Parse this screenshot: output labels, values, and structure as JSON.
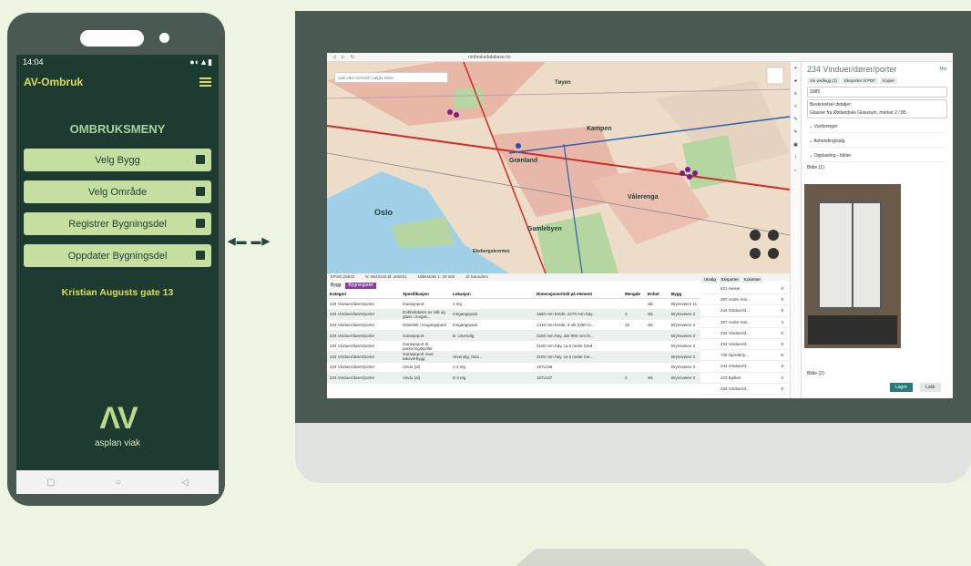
{
  "phone": {
    "status_time": "14:04",
    "app_title": "AV-Ombruk",
    "menu_title": "OMBRUKSMENY",
    "buttons": [
      "Velg Bygg",
      "Velg Område",
      "Registrer Bygningsdel",
      "Oppdater Bygningsdel"
    ],
    "address": "Kristian Augusts gate 13",
    "logo_text": "asplan viak"
  },
  "browser": {
    "url": "ombruksdatabase.no",
    "search_placeholder": "Søk etter innhold i valgte kilder",
    "map_labels": [
      "Oslo",
      "Grønland",
      "Kampen",
      "Vålerenga",
      "Gamlebyen",
      "Tøyen",
      "Ekebergskrenten"
    ],
    "map_status": [
      "EPSG:25832",
      "N: 6643149 Ø: 260021",
      "Målestokk 1: 20 000",
      "Jil Saunders"
    ],
    "bygg_tab": "Bygg",
    "bygningsdel_tab": "Bygningsdel",
    "table": {
      "headers": [
        "Kategori",
        "Spesifikasjon",
        "Lokasjon",
        "Dimensjoner/mål på element",
        "Mengde",
        "Enhet",
        "Bygg"
      ],
      "rows": [
        [
          "234 Vinduer/dører/porter",
          "Garasjeport",
          "1 etg",
          "",
          "",
          "stk",
          "Brynsveien 11"
        ],
        [
          "234 Vinduer/dører/porter",
          "Dobbeltdører av stål og glass i inngan...",
          "Inngangsparti",
          "1580 mm brede, 2270 mm høy...",
          "4",
          "stk",
          "Brynsveien 3"
        ],
        [
          "234 Vinduer/dører/porter",
          "Glassfelt i inngangsparti",
          "Inngangsparti",
          "1410 mm brede, 8 stk 2350 m...",
          "16",
          "stk",
          "Brynsveien 3"
        ],
        [
          "234 Vinduer/dører/porter",
          "Garasjeport",
          "B. Utvendig",
          "2200 mm høy, dør 900 mm br...",
          "",
          "",
          "Brynsveien 3"
        ],
        [
          "234 Vinduer/dører/porter",
          "Garasjeport til parkeringskjeller",
          "",
          "2100 mm høy, ca 6 meter bred",
          "",
          "",
          "Brynsveien 3"
        ],
        [
          "234 Vinduer/dører/porter",
          "Garasjeport med takoverbygg",
          "Utvendig, fasa...",
          "2100 mm høy, ca 6 meter bre...",
          "",
          "",
          "Brynsveien 3"
        ],
        [
          "234 Vinduer/dører/porter",
          "Vindu (al)",
          "A 2 etg",
          "157x138",
          "",
          "",
          "Brynsveien 3"
        ],
        [
          "234 Vinduer/dører/porter",
          "Vindu (al)",
          "B 3 etg",
          "157x137",
          "2",
          "stk",
          "Brynsveien 3"
        ]
      ]
    },
    "side_buttons": [
      "Utvalg",
      "Eksporter",
      "Kolonner"
    ],
    "side_items": [
      [
        "621 Heiser",
        "0"
      ],
      [
        "287 Andre reis...",
        "0"
      ],
      [
        "244 Vinduer/d...",
        "0"
      ],
      [
        "287 Andre reis...",
        "4"
      ],
      [
        "234 Vinduer/d...",
        "0"
      ],
      [
        "234 Vinduer/d...",
        "5"
      ],
      [
        "725 Gjerder/p...",
        "6"
      ],
      [
        "244 Vinduer/d...",
        "3"
      ],
      [
        "223 Bjelker",
        "3"
      ],
      [
        "234 Vinduer/d...",
        "0"
      ]
    ],
    "panel": {
      "title": "234 Vinduer/dører/porter",
      "link": "Mer",
      "buttons": [
        "Vis vedlegg (1)",
        "Eksporter til PDF",
        "Kopier"
      ],
      "year": "1985",
      "desc_label": "Beskrivelse/ detaljer:",
      "desc_value": "Glasser fra Østlandske Glassrum, merket 2 / 85.",
      "sections": [
        "Vurderinger",
        "Avhending/salg",
        "Opplasting - bilder"
      ],
      "image1_label": "Bilde (1):",
      "image2_label": "Bilde (2):",
      "save": "Lagre",
      "close": "Lukk"
    }
  }
}
